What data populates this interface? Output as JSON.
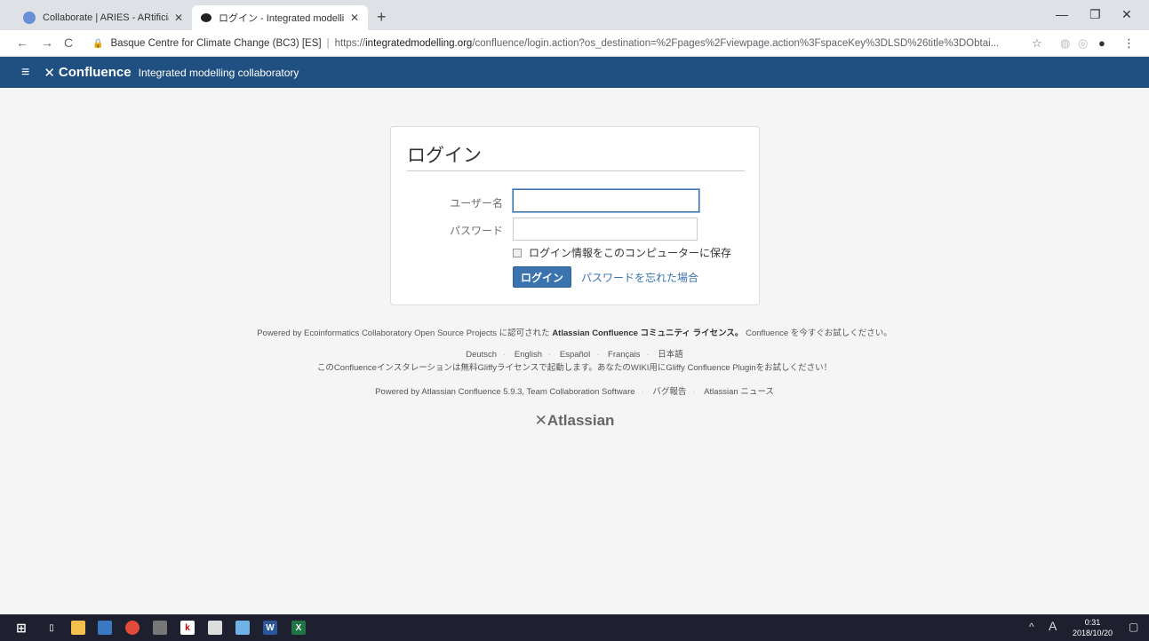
{
  "browser": {
    "tabs": [
      {
        "title": "Collaborate | ARIES - ARtificial Ir",
        "favicon_color": "#6a8fd6"
      },
      {
        "title": "ログイン - Integrated modelling co",
        "favicon_color": "#222222"
      }
    ],
    "address": {
      "org": "Basque Centre for Climate Change (BC3) [ES]",
      "scheme": "https://",
      "host": "integratedmodelling.org",
      "path": "/confluence/login.action?os_destination=%2Fpages%2Fviewpage.action%3FspaceKey%3DLSD%26title%3DObtai..."
    }
  },
  "app": {
    "product": "Confluence",
    "site_name": "Integrated modelling collaboratory",
    "header_color": "#205081"
  },
  "login": {
    "title": "ログイン",
    "username_label": "ユーザー名",
    "password_label": "パスワード",
    "username_value": "",
    "password_value": "",
    "remember_label": "ログイン情報をこのコンピューターに保存",
    "submit_label": "ログイン",
    "forgot_label": "パスワードを忘れた場合"
  },
  "footer": {
    "powered_prefix": "Powered by Ecoinformatics Collaboratory Open Source Projects に認可された",
    "license_name": "Atlassian Confluence コミュニティ ライセンス。",
    "powered_suffix": "Confluence を今すぐお試しください。",
    "languages": [
      "Deutsch",
      "English",
      "Español",
      "Français",
      "日本語"
    ],
    "gliffy_notice": "このConfluenceインスタレーションは無料Gliffyライセンスで起動します。あなたのWIKI用にGliffy Confluence Pluginをお試しください！",
    "powered_version": "Powered by Atlassian Confluence 5.9.3, Team Collaboration Software",
    "bug_report": "バグ報告",
    "news": "Atlassian ニュース",
    "atlassian_logo": "Atlassian"
  },
  "taskbar": {
    "time": "0:31",
    "date": "2018/10/20",
    "ime": "A"
  }
}
